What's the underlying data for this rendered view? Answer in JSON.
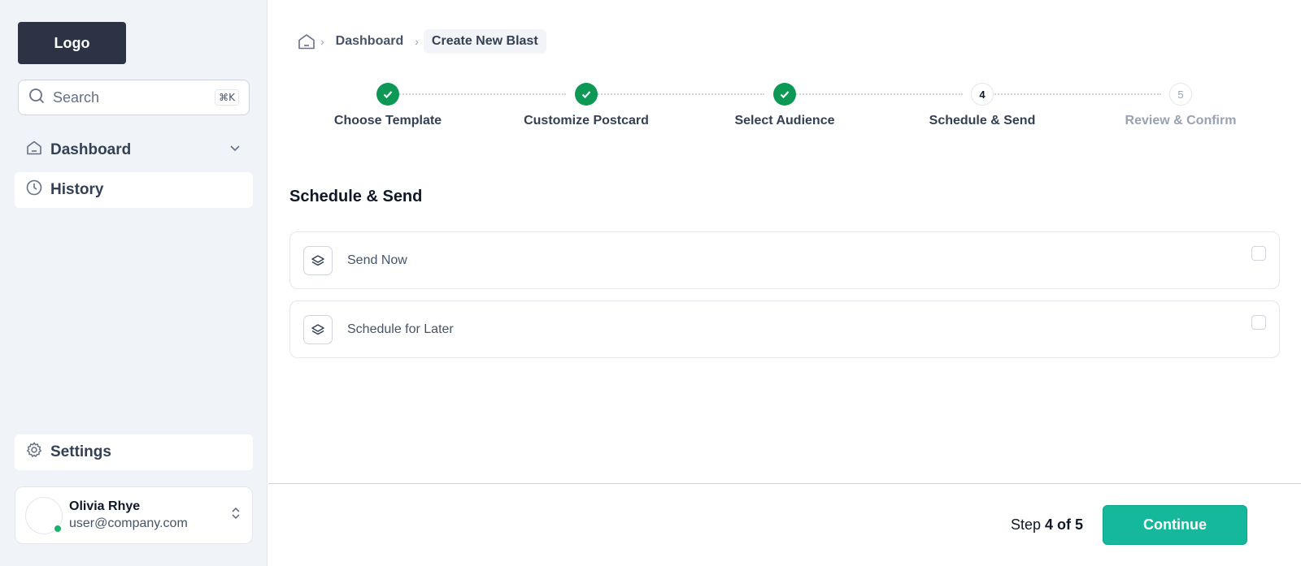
{
  "sidebar": {
    "logo": "Logo",
    "search": {
      "placeholder": "Search",
      "shortcut": "⌘K"
    },
    "nav": [
      {
        "label": "Dashboard",
        "icon": "home-icon",
        "has_chevron": true
      },
      {
        "label": "History",
        "icon": "clock-icon",
        "active": true
      }
    ],
    "settings": {
      "label": "Settings",
      "icon": "gear-icon"
    },
    "user": {
      "name": "Olivia Rhye",
      "email": "user@company.com",
      "status_color": "#17b26a"
    }
  },
  "breadcrumb": {
    "home_icon": "home-icon",
    "items": [
      "Dashboard",
      "Create New Blast"
    ]
  },
  "stepper": {
    "steps": [
      {
        "label": "Choose Template",
        "status": "done"
      },
      {
        "label": "Customize Postcard",
        "status": "done"
      },
      {
        "label": "Select Audience",
        "status": "done"
      },
      {
        "label": "Schedule & Send",
        "number": "4",
        "status": "current"
      },
      {
        "label": "Review & Confirm",
        "number": "5",
        "status": "future"
      }
    ],
    "done_color": "#0e9855"
  },
  "main": {
    "section_title": "Schedule & Send",
    "options": [
      {
        "label": "Send Now",
        "icon": "layers-icon",
        "checked": false
      },
      {
        "label": "Schedule for Later",
        "icon": "layers-icon",
        "checked": false
      }
    ]
  },
  "footer": {
    "step_prefix": "Step",
    "step_value": "4 of 5",
    "continue_label": "Continue",
    "accent": "#15b89a"
  }
}
